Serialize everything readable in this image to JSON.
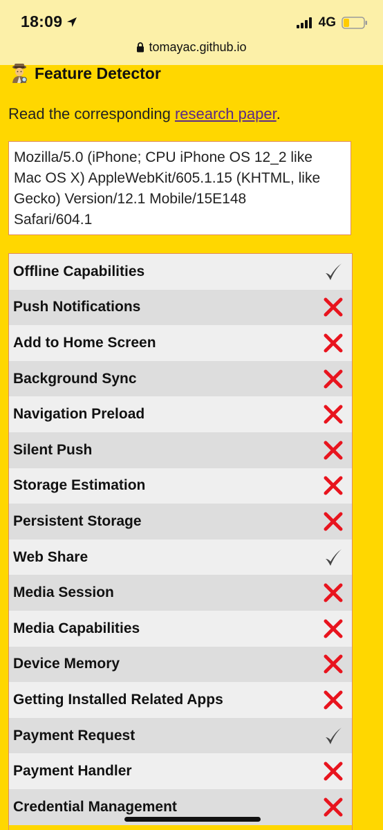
{
  "status_bar": {
    "time": "18:09",
    "network": "4G",
    "location_icon": "location-arrow-icon",
    "signal_icon": "cellular-signal-icon",
    "battery_icon": "battery-icon",
    "battery_color": "#FFCC00"
  },
  "browser": {
    "url": "tomayac.github.io",
    "lock_icon": "lock-icon"
  },
  "header": {
    "icon": "detective-emoji-icon",
    "title": "Feature Detector"
  },
  "intro": {
    "before": "Read the corresponding ",
    "link": "research paper",
    "after": "."
  },
  "user_agent": "Mozilla/5.0 (iPhone; CPU iPhone OS 12_2 like\nMac OS X) AppleWebKit/605.1.15 (KHTML, like\nGecko) Version/12.1 Mobile/15E148\nSafari/604.1",
  "colors": {
    "page_background": "#FFD700",
    "check": "#444444",
    "cross": "#E8141E",
    "border": "#E08A5C"
  },
  "features": [
    {
      "name": "Offline Capabilities",
      "supported": true
    },
    {
      "name": "Push Notifications",
      "supported": false
    },
    {
      "name": "Add to Home Screen",
      "supported": false
    },
    {
      "name": "Background Sync",
      "supported": false
    },
    {
      "name": "Navigation Preload",
      "supported": false
    },
    {
      "name": "Silent Push",
      "supported": false
    },
    {
      "name": "Storage Estimation",
      "supported": false
    },
    {
      "name": "Persistent Storage",
      "supported": false
    },
    {
      "name": "Web Share",
      "supported": true
    },
    {
      "name": "Media Session",
      "supported": false
    },
    {
      "name": "Media Capabilities",
      "supported": false
    },
    {
      "name": "Device Memory",
      "supported": false
    },
    {
      "name": "Getting Installed Related Apps",
      "supported": false
    },
    {
      "name": "Payment Request",
      "supported": true
    },
    {
      "name": "Payment Handler",
      "supported": false
    },
    {
      "name": "Credential Management",
      "supported": false
    }
  ]
}
